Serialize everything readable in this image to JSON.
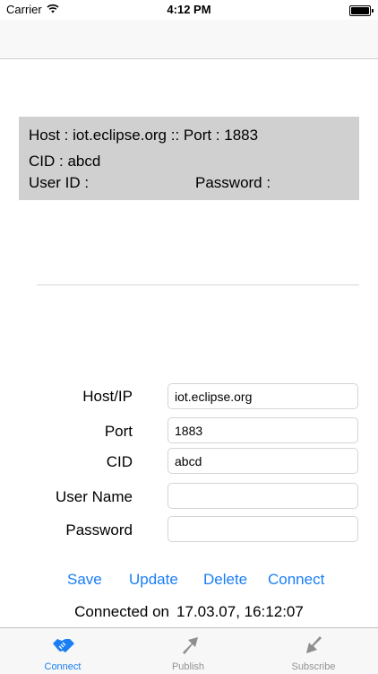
{
  "status_bar": {
    "carrier": "Carrier",
    "time": "4:12 PM"
  },
  "info_box": {
    "host_line": "Host : iot.eclipse.org :: Port : 1883",
    "cid_line": "CID : abcd",
    "user_line": "User ID :",
    "password_line": "Password :"
  },
  "form": {
    "host": {
      "label": "Host/IP",
      "value": "iot.eclipse.org"
    },
    "port": {
      "label": "Port",
      "value": "1883"
    },
    "cid": {
      "label": "CID",
      "value": "abcd"
    },
    "user_name": {
      "label": "User Name",
      "value": ""
    },
    "password": {
      "label": "Password",
      "value": ""
    }
  },
  "actions": {
    "save": "Save",
    "update": "Update",
    "delete": "Delete",
    "connect": "Connect"
  },
  "status": {
    "prefix": "Connected on",
    "timestamp": "17.03.07, 16:12:07"
  },
  "tabs": [
    {
      "label": "Connect",
      "icon": "handshake-icon",
      "active": true
    },
    {
      "label": "Publish",
      "icon": "arrow-up-right-icon",
      "active": false
    },
    {
      "label": "Subscribe",
      "icon": "arrow-down-left-icon",
      "active": false
    }
  ],
  "colors": {
    "accent": "#1a7ef5",
    "inactive": "#929292",
    "info_box_bg": "#d0d0d0"
  }
}
